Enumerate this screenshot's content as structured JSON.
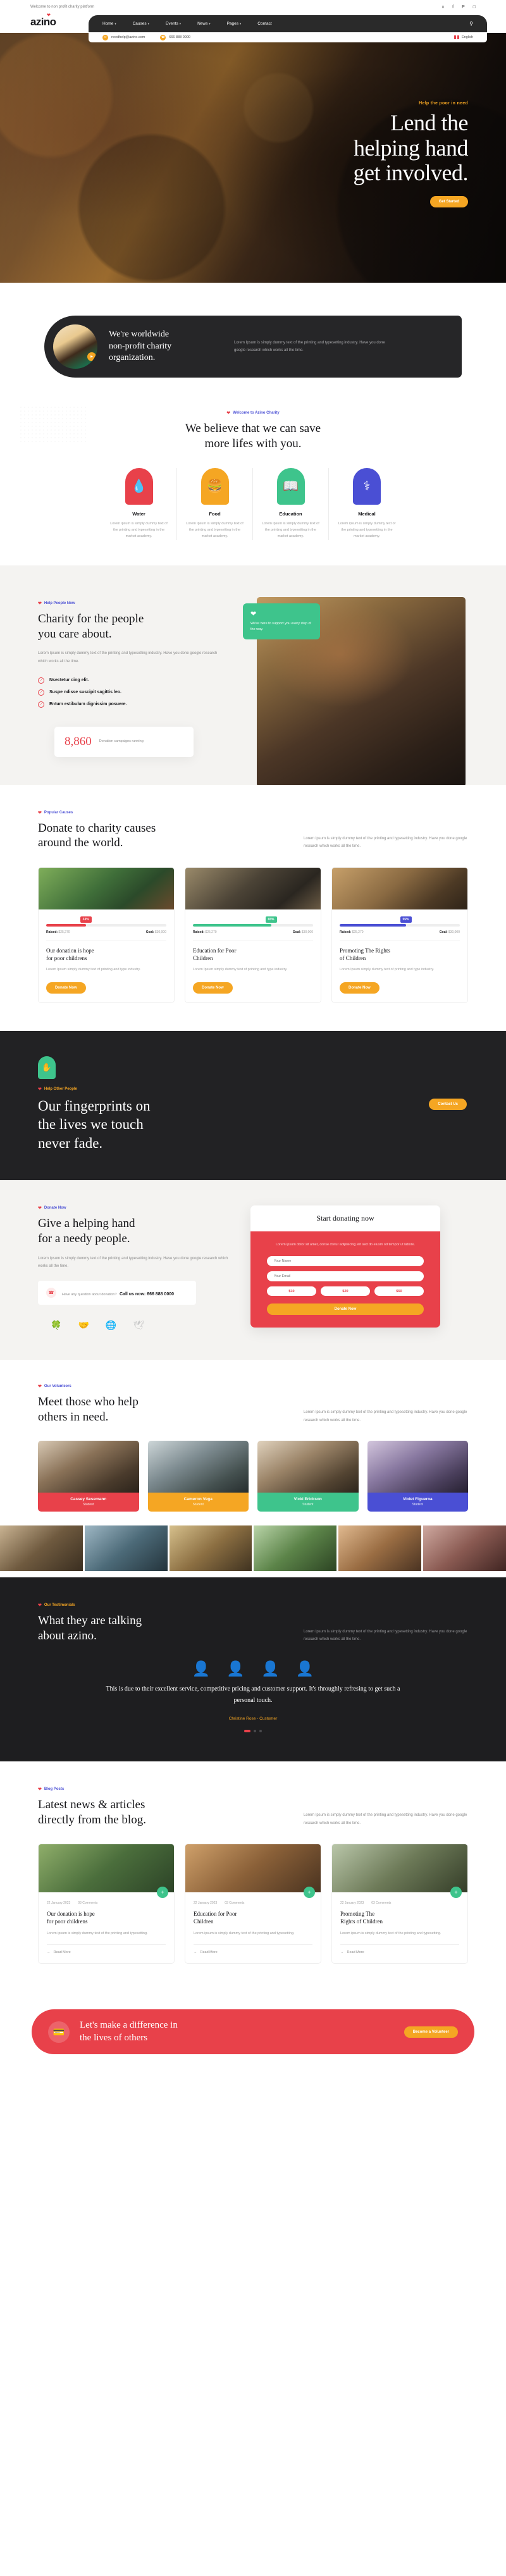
{
  "topbar": {
    "welcome": "Welcome to non profit charity platform",
    "socials": [
      "twitter-icon",
      "facebook-icon",
      "pinterest-icon",
      "instagram-icon"
    ]
  },
  "nav": {
    "logo": "azino",
    "items": [
      {
        "label": "Home",
        "caret": "⌄"
      },
      {
        "label": "Causes",
        "caret": "⌄"
      },
      {
        "label": "Events",
        "caret": "⌄"
      },
      {
        "label": "News",
        "caret": "⌄"
      },
      {
        "label": "Pages",
        "caret": "⌄"
      },
      {
        "label": "Contact",
        "caret": ""
      }
    ],
    "search_icon": "⌕"
  },
  "contactbar": {
    "email": "needhelp@azino.com",
    "phone": "666 888 0000",
    "language": "English"
  },
  "hero": {
    "eyebrow": "Help the poor in need",
    "title_line1": "Lend the",
    "title_line2": "helping hand",
    "title_line3": "get involved.",
    "cta": "Get Started"
  },
  "about": {
    "title_line1": "We're worldwide",
    "title_line2": "non-profit charity",
    "title_line3": "organization.",
    "text": "Lorem Ipsum is simply dummy text of the printing and typesetting industry. Have you done google research which works all the time.",
    "play_icon": "▶"
  },
  "services": {
    "label": "Welcome to Azino Charity",
    "title_line1": "We believe that we can save",
    "title_line2": "more lifes with you.",
    "items": [
      {
        "name": "Water",
        "icon": "⌇",
        "color": "red",
        "text": "Lorem ipsum is simply dummy text of the printing and typesetting in the market academy."
      },
      {
        "name": "Food",
        "icon": "ἵ4",
        "color": "orange",
        "text": "Lorem ipsum is simply dummy text of the printing and typesetting in the market academy."
      },
      {
        "name": "Education",
        "icon": "Ὅ6",
        "color": "green",
        "text": "Lorem ipsum is simply dummy text of the printing and typesetting in the market academy."
      },
      {
        "name": "Medical",
        "icon": "⚕",
        "color": "blue",
        "text": "Lorem ipsum is simply dummy text of the printing and typesetting in the market academy."
      }
    ]
  },
  "charity": {
    "label": "Help People Now",
    "title_line1": "Charity for the people",
    "title_line2": "you care about.",
    "text": "Lorem Ipsum is simply dummy text of the printing and typesetting industry. Have you done google research which works all the time.",
    "checks": [
      "Nsectetur cing elit.",
      "Suspe ndisse suscipit sagittis leo.",
      "Entum estibulum dignissim posuere."
    ],
    "stat_number": "8,860",
    "stat_label": "Donation campaigns\nrunning",
    "badge_icon": "❤",
    "badge_text": "We're here to support you every step of the way."
  },
  "causes": {
    "label": "Popular Causes",
    "title_line1": "Donate to charity causes",
    "title_line2": "around the world.",
    "text": "Lorem Ipsum is simply dummy text of the printing and typesetting industry. Have you done google research which works all the time.",
    "raised_label": "Raised:",
    "goal_label": "Goal:",
    "items": [
      {
        "percent": "33%",
        "percent_value": 33,
        "color": "#e8414a",
        "raised": "$25,270",
        "goal": "$30,000",
        "title_line1": "Our donation is hope",
        "title_line2": "for poor childrens",
        "text": "Lorem Ipsum simply dummy text of printing and type industry.",
        "cta": "Donate Now"
      },
      {
        "percent": "65%",
        "percent_value": 65,
        "color": "#3ec48c",
        "raised": "$25,270",
        "goal": "$30,000",
        "title_line1": "Education for Poor",
        "title_line2": "Children",
        "text": "Lorem Ipsum simply dummy text of printing and type industry.",
        "cta": "Donate Now"
      },
      {
        "percent": "55%",
        "percent_value": 55,
        "color": "#4a4fd4",
        "raised": "$25,270",
        "goal": "$30,000",
        "title_line1": "Promoting The Rights",
        "title_line2": "of Children",
        "text": "Lorem Ipsum simply dummy text of printing and type industry.",
        "cta": "Donate Now"
      }
    ]
  },
  "fingerprint": {
    "label": "Help Other People",
    "icon": "✋",
    "title_line1": "Our fingerprints on",
    "title_line2": "the lives we touch",
    "title_line3": "never fade.",
    "cta": "Contact Us"
  },
  "donate": {
    "label": "Donate Now",
    "title_line1": "Give a helping hand",
    "title_line2": "for a needy people.",
    "text": "Lorem Ipsum is simply dummy text of the printing and typesetting industry. Have you done google research which works all the time.",
    "question": "Have any question about donation?",
    "call_prefix": "Call us now:",
    "call_number": "666 888 0000",
    "form_title": "Start donating now",
    "form_text": "Lorem ipsum dolor sit amet, conse ctetur adipisicing elit sed do eiusm od tempor ut labore.",
    "field_name": "Your Name",
    "field_email": "Your Email",
    "amounts": [
      "$10",
      "$20",
      "$50"
    ],
    "form_cta": "Donate Now",
    "partner_logos": [
      "leaf-logo",
      "hands-logo",
      "globe-logo",
      "dove-logo"
    ]
  },
  "team": {
    "label": "Our Volunteers",
    "title_line1": "Meet those who help",
    "title_line2": "others in need.",
    "text": "Lorem Ipsum is simply dummy text of the printing and typesetting industry. Have you done google research which works all the time.",
    "members": [
      {
        "name": "Cassey Sesemann",
        "role": "Student",
        "color": "red"
      },
      {
        "name": "Cameron Vega",
        "role": "Student",
        "color": "orange"
      },
      {
        "name": "Vicki Erickson",
        "role": "Student",
        "color": "green"
      },
      {
        "name": "Violet Figueroa",
        "role": "Student",
        "color": "blue"
      }
    ]
  },
  "testimonials": {
    "label": "Our Testimonials",
    "title_line1": "What they are talking",
    "title_line2": "about azino.",
    "text": "Lorem Ipsum is simply dummy text of the printing and typesetting industry. Have you done google research which works all the time.",
    "quote": "This is due to their excellent service, competitive pricing and customer support. It's throughly refresing to get such a personal touch.",
    "author": "Christine Rose",
    "author_role": "- Customer"
  },
  "blog": {
    "label": "Blog Posts",
    "title_line1": "Latest news & articles",
    "title_line2": "directly from the blog.",
    "text": "Lorem Ipsum is simply dummy text of the printing and typesetting industry. Have you done google research which works all the time.",
    "read_more": "Read More",
    "posts": [
      {
        "date": "22 January 2023",
        "comments": "03 Comments",
        "title_line1": "Our donation is hope",
        "title_line2": "for poor childrens",
        "text": "Lorem ipsum is simply dummy text of the printing and typesetting."
      },
      {
        "date": "22 January 2023",
        "comments": "03 Comments",
        "title_line1": "Education for Poor",
        "title_line2": "Children",
        "text": "Lorem ipsum is simply dummy text of the printing and typesetting."
      },
      {
        "date": "22 January 2023",
        "comments": "03 Comments",
        "title_line1": "Promoting The",
        "title_line2": "Rights of Children",
        "text": "Lorem ipsum is simply dummy text of the printing and typesetting."
      }
    ]
  },
  "bottom_cta": {
    "icon": "Ὃ3",
    "title_line1": "Let's make a difference in",
    "title_line2": "the lives of others",
    "cta": "Become a Volunteer"
  },
  "colors": {
    "red": "#e8414a",
    "orange": "#f5a623",
    "green": "#3ec48c",
    "blue": "#4a4fd4",
    "dark": "#222224"
  }
}
